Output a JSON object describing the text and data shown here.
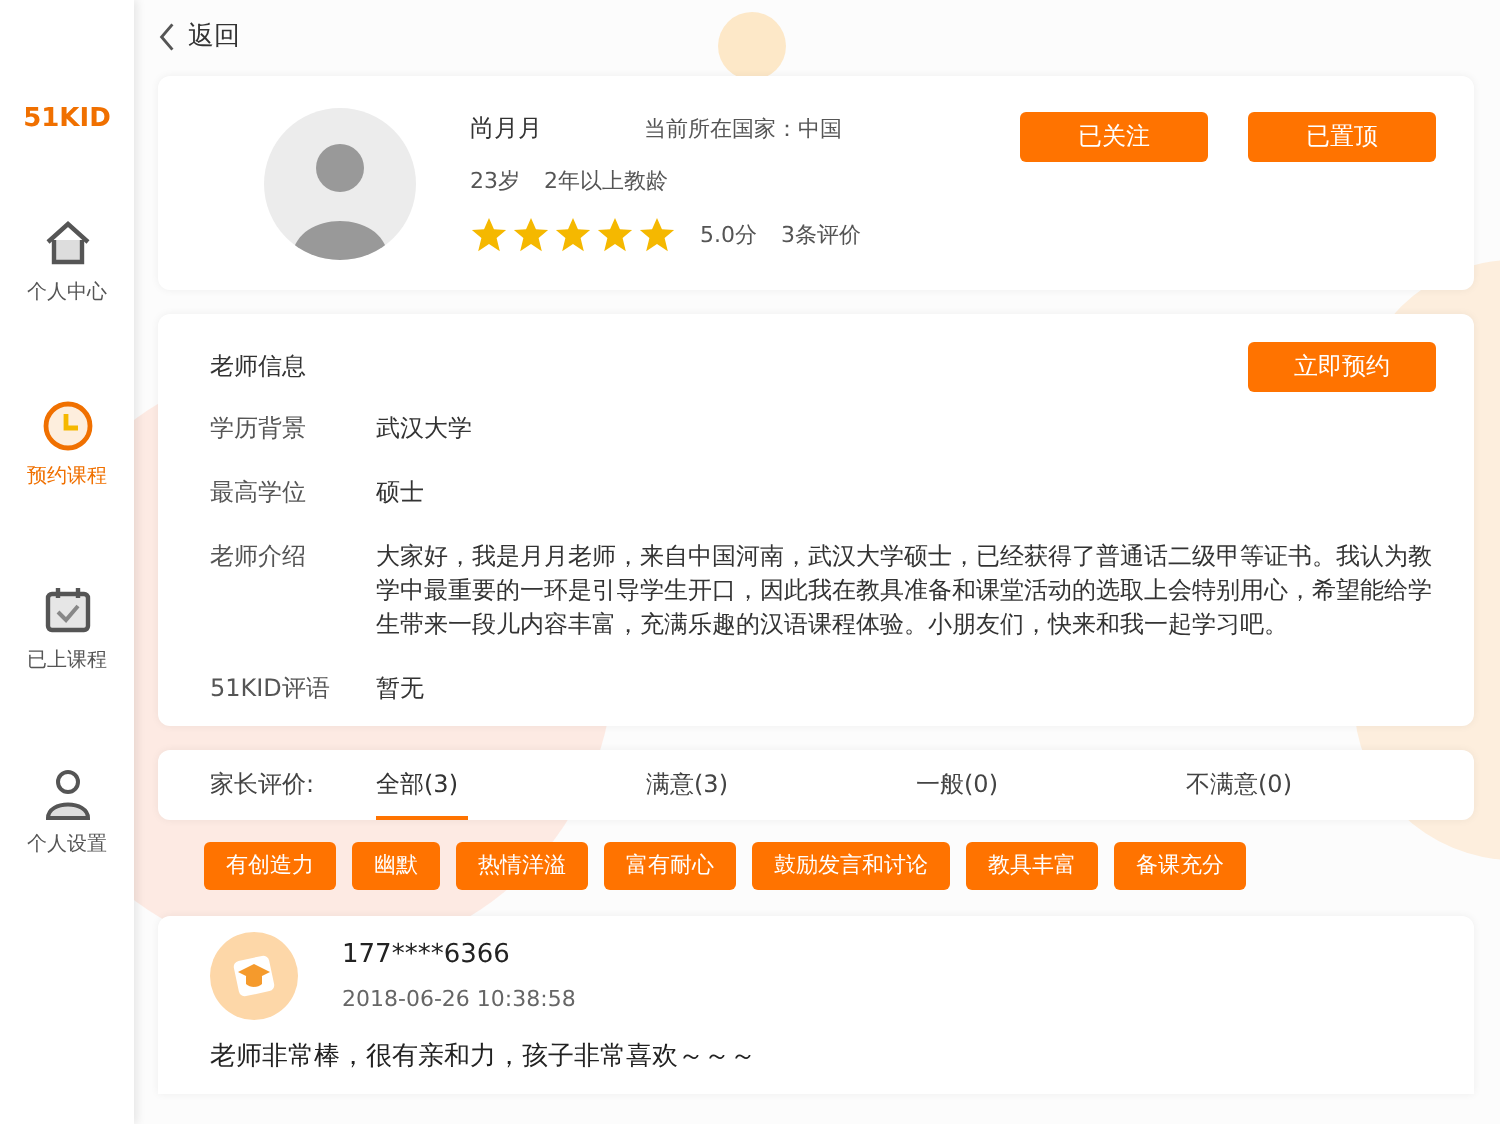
{
  "sidebar": {
    "logo": "51KID",
    "items": [
      {
        "label": "个人中心",
        "selected": false
      },
      {
        "label": "预约课程",
        "selected": true
      },
      {
        "label": "已上课程",
        "selected": false
      },
      {
        "label": "个人设置",
        "selected": false
      }
    ]
  },
  "back": {
    "label": "返回"
  },
  "profile": {
    "name": "尚月月",
    "country": "当前所在国家：中国",
    "age": "23岁",
    "experience": "2年以上教龄",
    "stars": 5,
    "score": "5.0分",
    "reviews": "3条评价",
    "buttons": [
      "已关注",
      "已置顶"
    ]
  },
  "info": {
    "title": "老师信息",
    "book_button": "立即预约",
    "rows": [
      {
        "label": "学历背景",
        "value": "武汉大学"
      },
      {
        "label": "最高学位",
        "value": "硕士"
      },
      {
        "label": "老师介绍",
        "value": "大家好，我是月月老师，来自中国河南，武汉大学硕士，已经获得了普通话二级甲等证书。我认为教学中最重要的一环是引导学生开口，因此我在教具准备和课堂活动的选取上会特别用心，希望能给学生带来一段儿内容丰富，充满乐趣的汉语课程体验。小朋友们，快来和我一起学习吧。"
      },
      {
        "label": "51KID评语",
        "value": "暂无"
      }
    ]
  },
  "reviews": {
    "label": "家长评价:",
    "tabs": [
      {
        "label": "全部(3)",
        "selected": true
      },
      {
        "label": "满意(3)",
        "selected": false
      },
      {
        "label": "一般(0)",
        "selected": false
      },
      {
        "label": "不满意(0)",
        "selected": false
      }
    ],
    "tags": [
      "有创造力",
      "幽默",
      "热情洋溢",
      "富有耐心",
      "鼓励发言和讨论",
      "教具丰富",
      "备课充分"
    ],
    "items": [
      {
        "user": "177****6366",
        "date": "2018-06-26 10:38:58",
        "comment": "老师非常棒，很有亲和力，孩子非常喜欢～～～"
      }
    ]
  }
}
